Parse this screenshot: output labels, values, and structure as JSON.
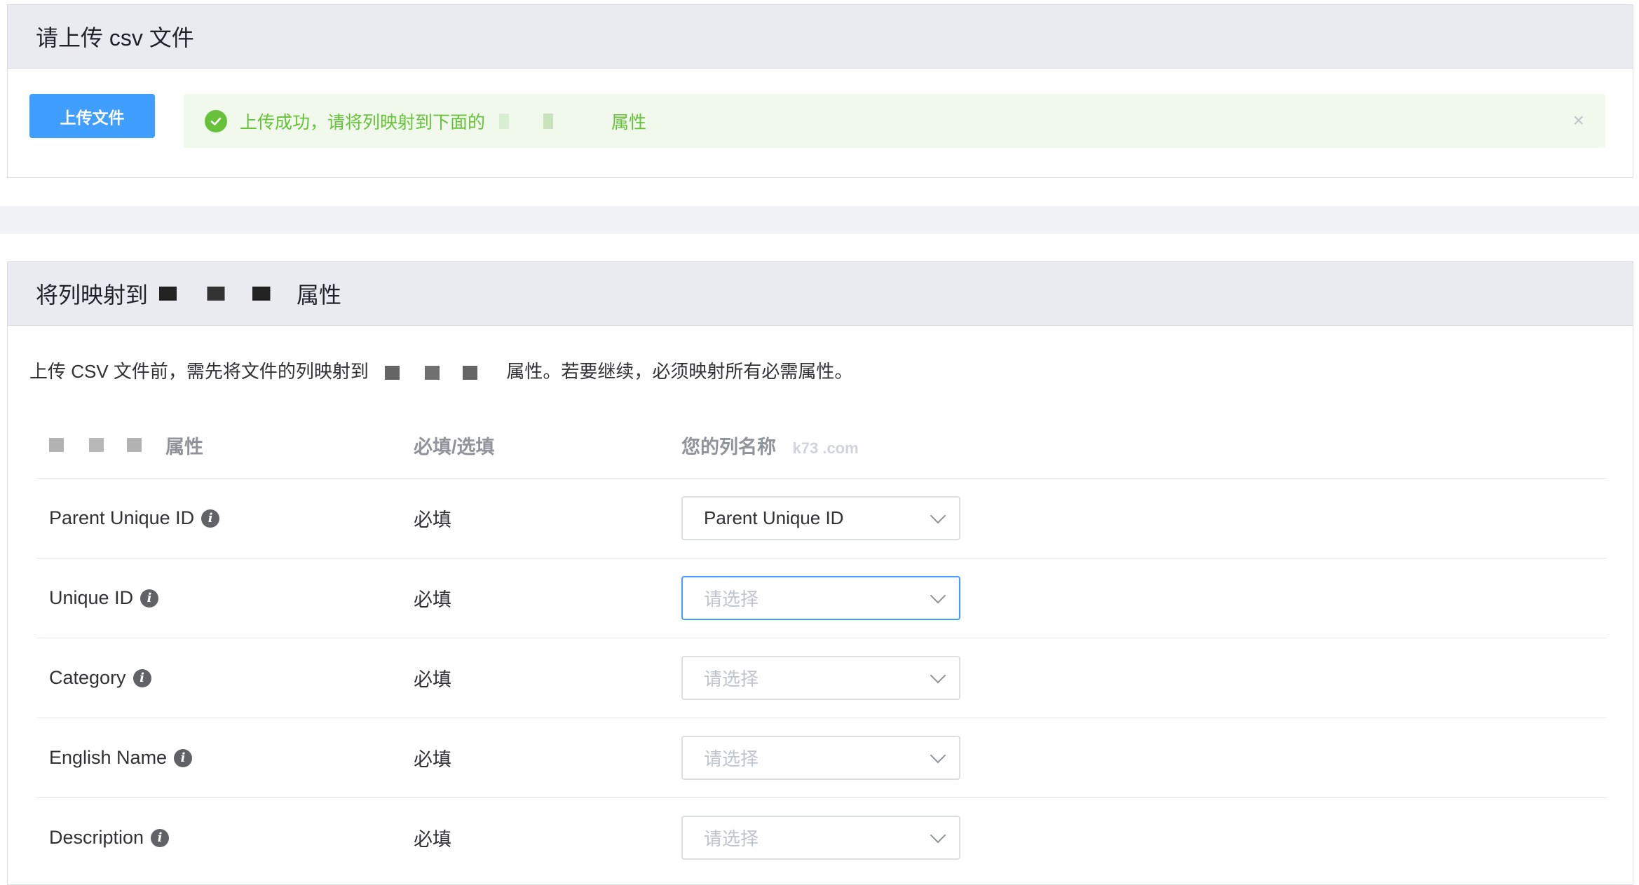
{
  "upload_card": {
    "title": "请上传 csv 文件",
    "upload_button": "上传文件",
    "alert": {
      "message_prefix": "上传成功，请将列映射到下面的",
      "message_suffix": "属性",
      "close": "×"
    }
  },
  "mapping_card": {
    "title_prefix": "将列映射到",
    "title_suffix": "属性",
    "description_prefix": "上传 CSV 文件前，需先将文件的列映射到",
    "description_suffix": "属性。若要继续，必须映射所有必需属性。",
    "columns": {
      "attribute": "属性",
      "required": "必填/选填",
      "your_column": "您的列名称"
    },
    "watermark": "k73 .com",
    "rows": [
      {
        "name": "Parent Unique ID",
        "required": "必填",
        "selected": "Parent Unique ID",
        "placeholder": ""
      },
      {
        "name": "Unique ID",
        "required": "必填",
        "selected": "",
        "placeholder": "请选择"
      },
      {
        "name": "Category",
        "required": "必填",
        "selected": "",
        "placeholder": "请选择"
      },
      {
        "name": "English Name",
        "required": "必填",
        "selected": "",
        "placeholder": "请选择"
      },
      {
        "name": "Description",
        "required": "必填",
        "selected": "",
        "placeholder": "请选择"
      }
    ]
  },
  "icons": {
    "success": "check-circle-icon",
    "info": "info-circle-icon",
    "dropdown": "chevron-down-icon",
    "close": "close-icon"
  },
  "colors": {
    "primary": "#409eff",
    "success": "#67c23a",
    "success_bg": "#f0f9eb",
    "header_bg": "#e9ebf0"
  }
}
